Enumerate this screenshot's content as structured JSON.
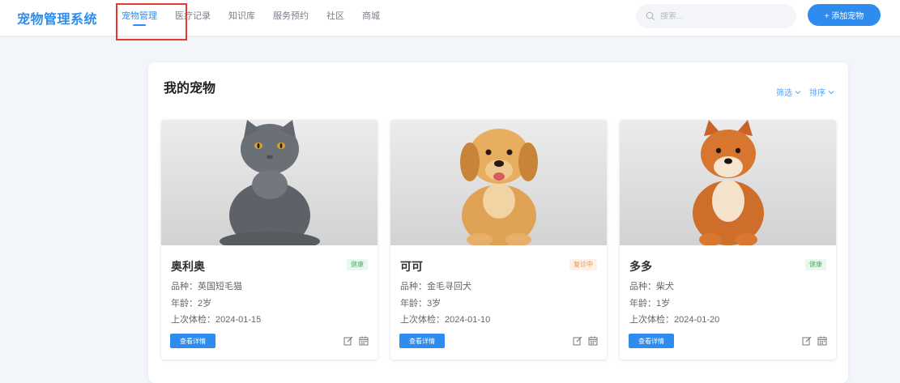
{
  "app": {
    "title": "宠物管理系统"
  },
  "nav": {
    "items": [
      {
        "label": "宠物管理",
        "active": true
      },
      {
        "label": "医疗记录",
        "active": false
      },
      {
        "label": "知识库",
        "active": false
      },
      {
        "label": "服务预约",
        "active": false
      },
      {
        "label": "社区",
        "active": false
      },
      {
        "label": "商城",
        "active": false
      }
    ]
  },
  "search": {
    "placeholder": "搜索..."
  },
  "header": {
    "add_label": "+ 添加宠物"
  },
  "panel": {
    "title": "我的宠物",
    "filter_label": "筛选",
    "sort_label": "排序"
  },
  "pets": [
    {
      "name": "奥利奥",
      "status": "健康",
      "status_type": "healthy",
      "breed": "品种：英国短毛猫",
      "age": "年龄：2岁",
      "last_check": "上次体检：2024-01-15",
      "detail_label": "查看详情",
      "photo": "gray british shorthair cat"
    },
    {
      "name": "可可",
      "status": "复诊中",
      "status_type": "recovering",
      "breed": "品种：金毛寻回犬",
      "age": "年龄：3岁",
      "last_check": "上次体检：2024-01-10",
      "detail_label": "查看详情",
      "photo": "golden retriever puppy"
    },
    {
      "name": "多多",
      "status": "健康",
      "status_type": "healthy",
      "breed": "品种：柴犬",
      "age": "年龄：1岁",
      "last_check": "上次体检：2024-01-20",
      "detail_label": "查看详情",
      "photo": "shiba inu dog"
    }
  ],
  "colors": {
    "accent": "#2f8cef",
    "healthy": "#4cb86a",
    "recovering": "#e8964a",
    "highlight": "#e53935"
  },
  "icons": [
    "search-icon",
    "chevron-down-icon",
    "edit-icon",
    "calendar-icon"
  ]
}
